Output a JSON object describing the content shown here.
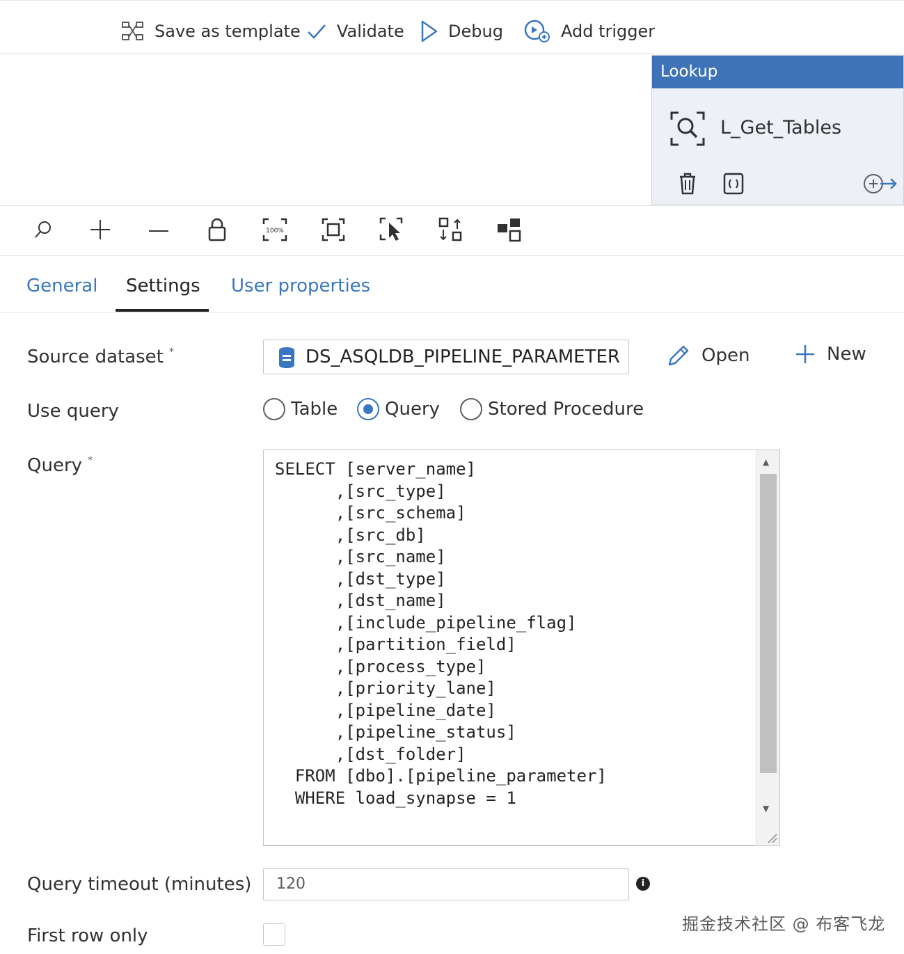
{
  "toolbar": {
    "save_template": "Save as template",
    "validate": "Validate",
    "debug": "Debug",
    "add_trigger": "Add trigger"
  },
  "activity": {
    "type": "Lookup",
    "name": "L_Get_Tables"
  },
  "tabs": [
    "General",
    "Settings",
    "User properties"
  ],
  "active_tab": "Settings",
  "form": {
    "source_dataset_label": "Source dataset",
    "source_dataset_value": "DS_ASQLDB_PIPELINE_PARAMETER",
    "open_label": "Open",
    "new_label": "New",
    "use_query_label": "Use query",
    "use_query_options": [
      "Table",
      "Query",
      "Stored Procedure"
    ],
    "use_query_selected": "Query",
    "query_label": "Query",
    "query_text": "SELECT [server_name]\n      ,[src_type]\n      ,[src_schema]\n      ,[src_db]\n      ,[src_name]\n      ,[dst_type]\n      ,[dst_name]\n      ,[include_pipeline_flag]\n      ,[partition_field]\n      ,[process_type]\n      ,[priority_lane]\n      ,[pipeline_date]\n      ,[pipeline_status]\n      ,[dst_folder]\n  FROM [dbo].[pipeline_parameter]\n  WHERE load_synapse = 1",
    "query_timeout_label": "Query timeout (minutes)",
    "query_timeout_value": "120",
    "first_row_only_label": "First row only",
    "first_row_only_checked": false,
    "required_mark": "*"
  },
  "watermark": "掘金技术社区 @ 布客飞龙",
  "colors": {
    "accent": "#3a77c2",
    "lookup_header": "#3f73b8",
    "lookup_body": "#edf1f7"
  },
  "icons": {
    "canvas_toolbar": [
      "search-icon",
      "zoom-in-icon",
      "zoom-out-icon",
      "lock-icon",
      "zoom-100-icon",
      "fit-to-window-icon",
      "select-icon",
      "auto-align-icon",
      "layout-icon"
    ]
  }
}
